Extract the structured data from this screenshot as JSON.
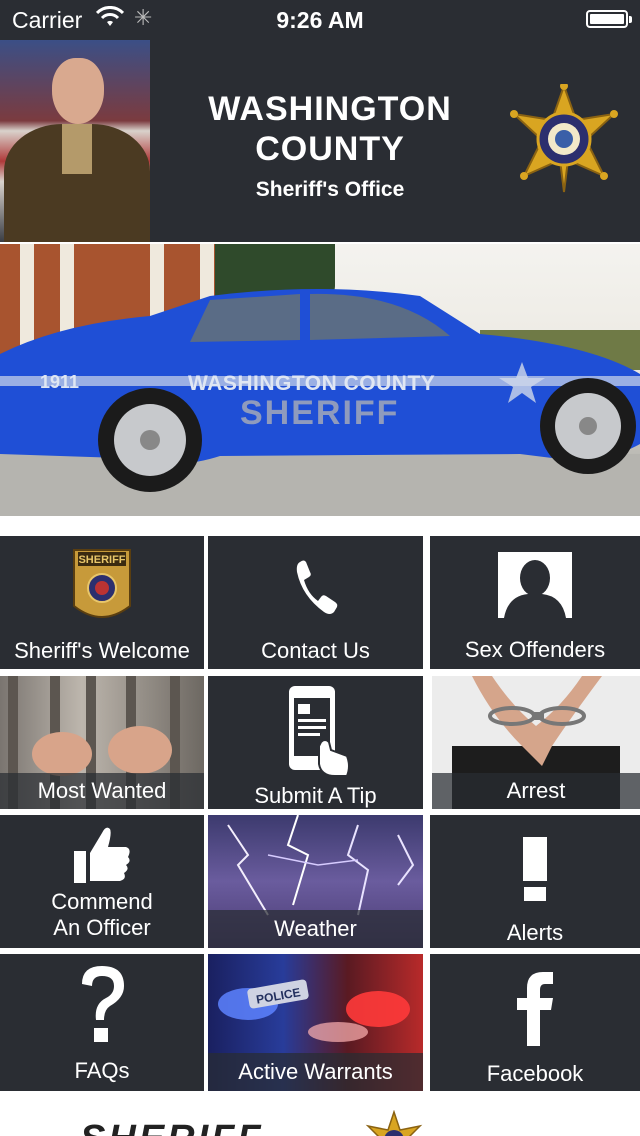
{
  "status_bar": {
    "carrier": "Carrier",
    "time": "9:26 AM",
    "battery_level": 1.0
  },
  "header": {
    "title_line1": "WASHINGTON",
    "title_line2": "COUNTY",
    "subtitle": "Sheriff's Office",
    "badge_icon": "sheriff-star-badge-icon",
    "portrait_image": "sheriff-portrait"
  },
  "hero": {
    "car_text_1911": "1911",
    "car_text_county": "WASHINGTON COUNTY",
    "car_text_sheriff": "SHERIFF"
  },
  "tiles": [
    {
      "label": "Sheriff's Welcome",
      "icon": "sheriff-patch-icon"
    },
    {
      "label": "Contact Us",
      "icon": "phone-icon"
    },
    {
      "label": "Sex Offenders",
      "icon": "silhouette-icon"
    },
    {
      "label": "Most Wanted",
      "icon": "jail-bars-image"
    },
    {
      "label": "Submit A Tip",
      "icon": "phone-tap-icon"
    },
    {
      "label": "Arrest",
      "icon": "handcuffs-image"
    },
    {
      "label_line1": "Commend",
      "label_line2": "An Officer",
      "icon": "thumbs-up-icon"
    },
    {
      "label": "Weather",
      "icon": "lightning-image"
    },
    {
      "label": "Alerts",
      "icon": "exclamation-icon"
    },
    {
      "label": "FAQs",
      "icon": "question-icon"
    },
    {
      "label": "Active Warrants",
      "icon": "police-lights-image"
    },
    {
      "label": "Facebook",
      "icon": "facebook-icon"
    }
  ],
  "footer": {
    "sheriff_word": "SHERIFF"
  },
  "colors": {
    "tile_bg": "#2a2d33",
    "badge_gold": "#d9a521",
    "badge_navy": "#2c2f6e",
    "car_blue": "#1f4fd6"
  }
}
